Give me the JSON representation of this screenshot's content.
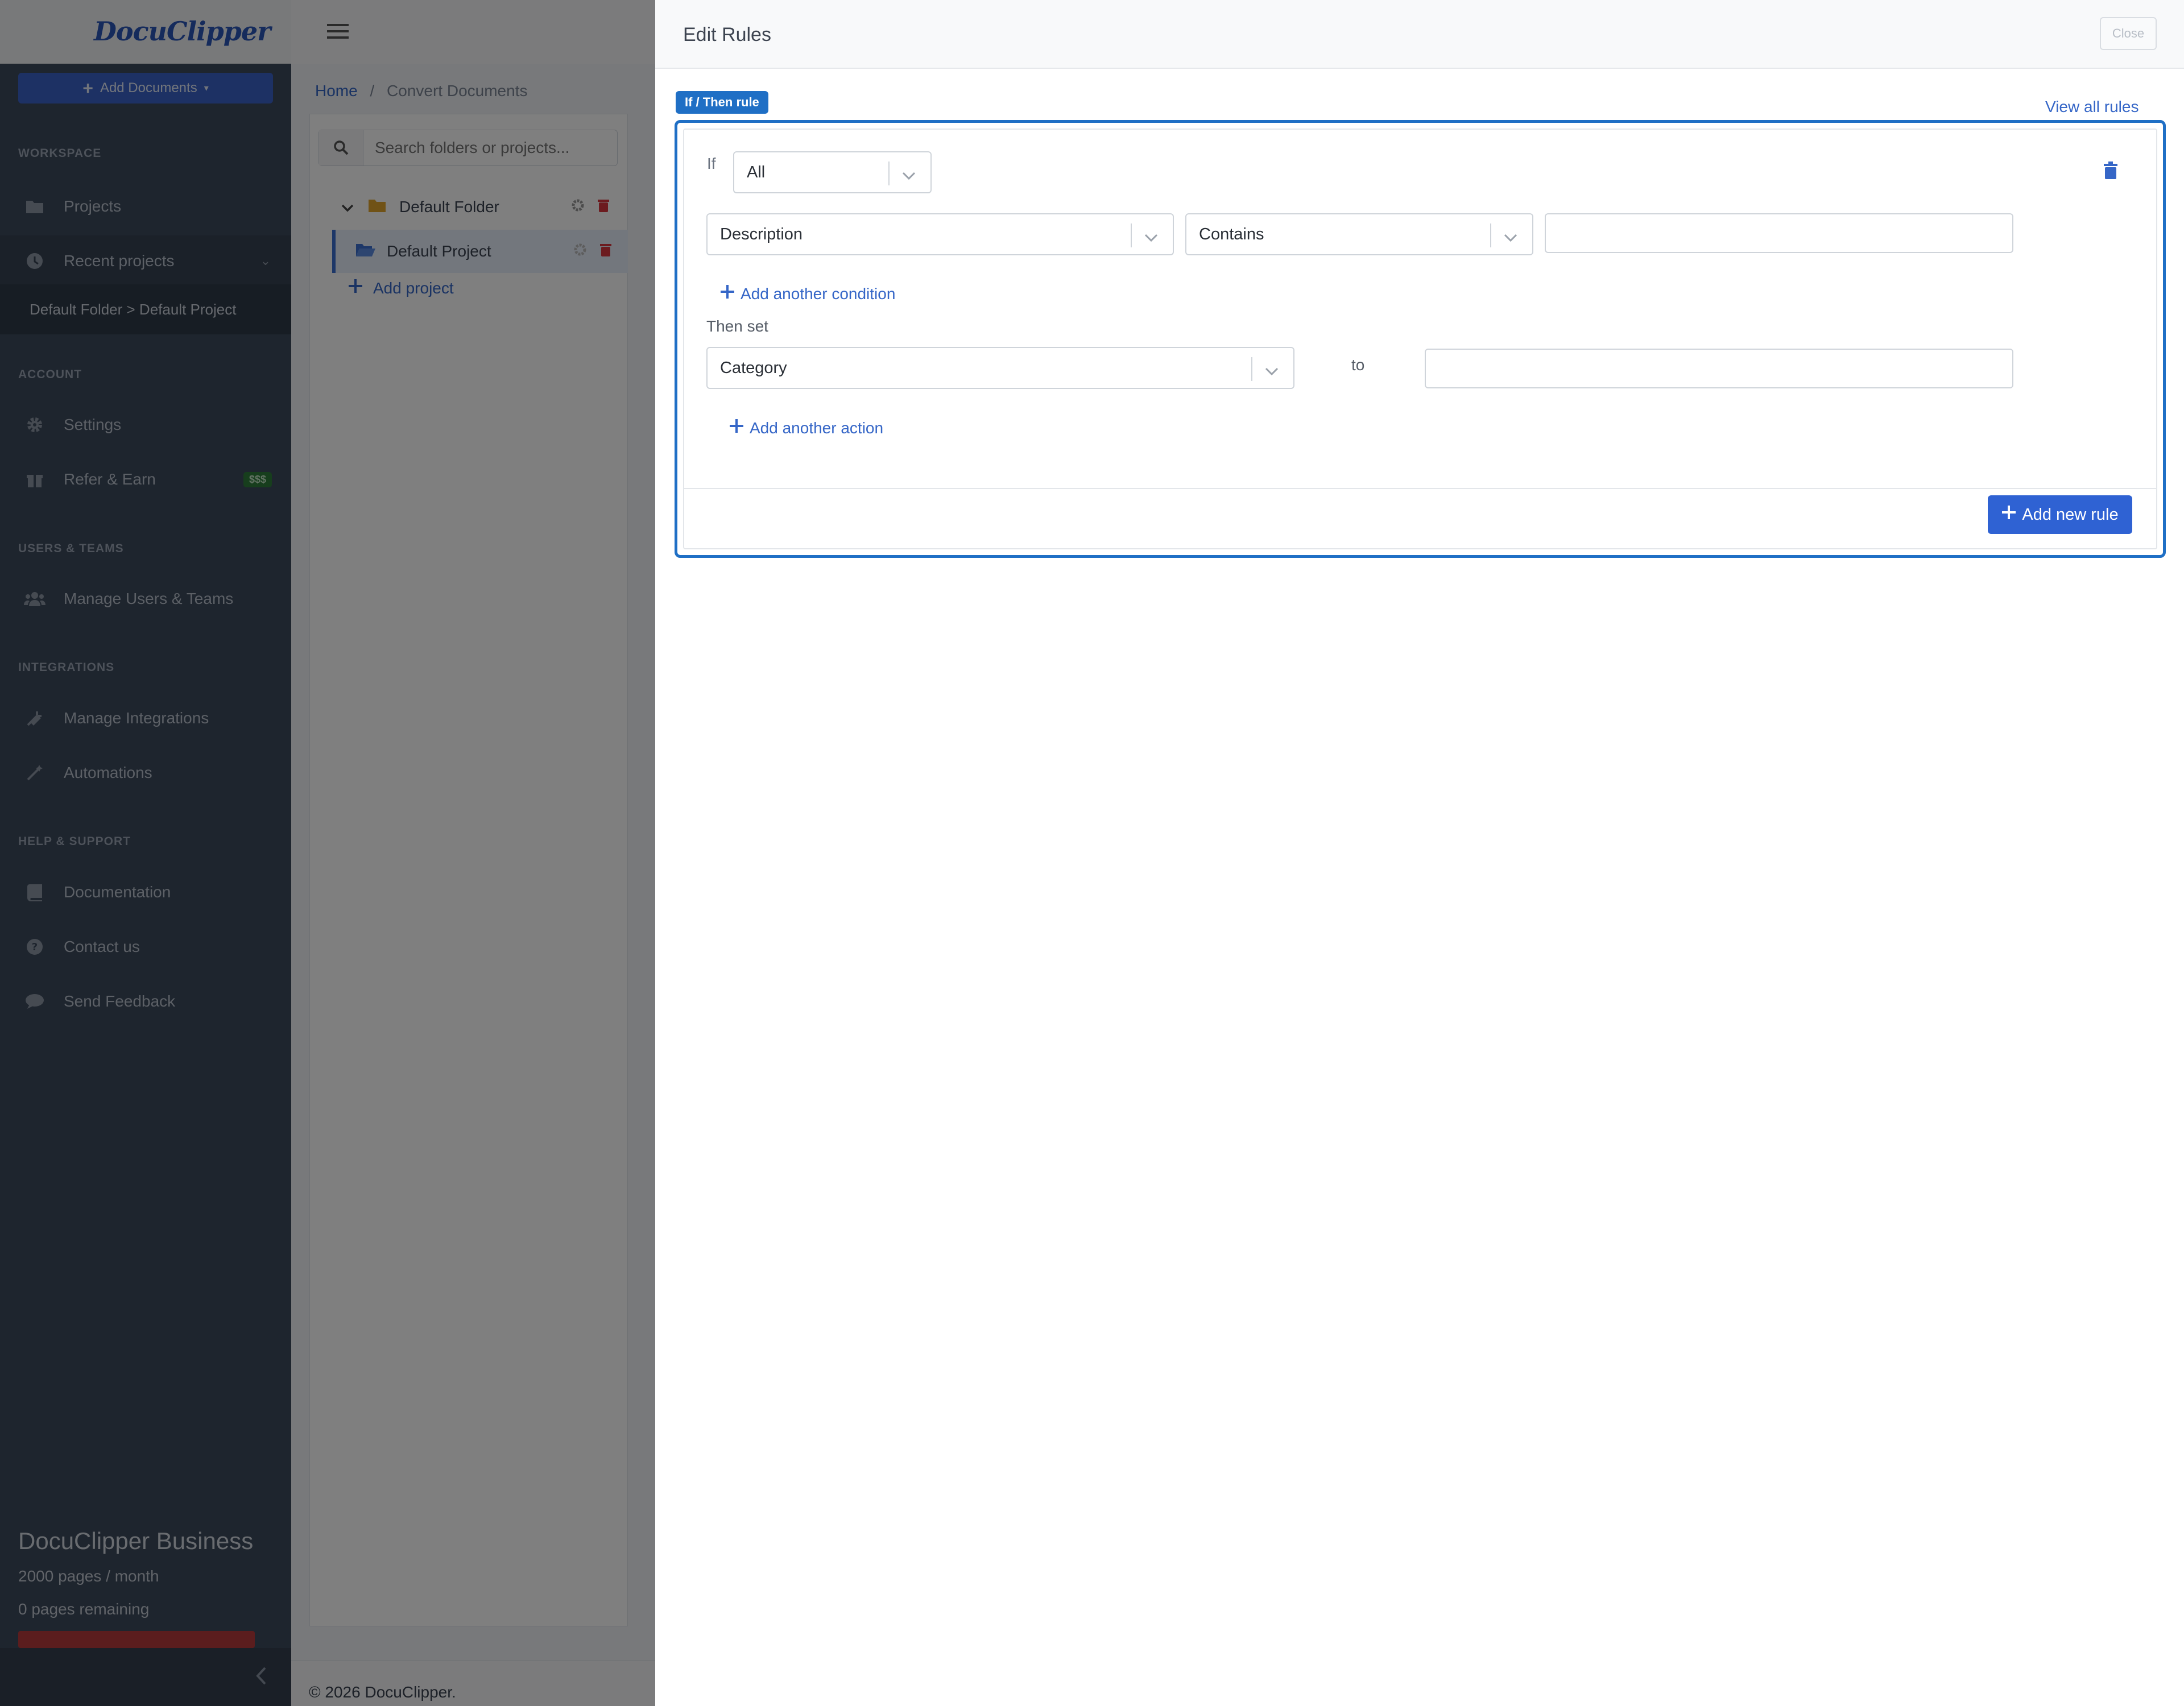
{
  "app": {
    "logo": "DocuClipper"
  },
  "sidebar": {
    "add_documents": "Add Documents",
    "sections": {
      "workspace": "WORKSPACE",
      "account": "ACCOUNT",
      "users_teams": "USERS & TEAMS",
      "integrations": "INTEGRATIONS",
      "help_support": "HELP & SUPPORT"
    },
    "items": {
      "projects": "Projects",
      "recent_projects": "Recent projects",
      "recent_sub": "Default Folder > Default Project",
      "settings": "Settings",
      "refer_earn": "Refer & Earn",
      "refer_badge": "$$$",
      "manage_users": "Manage Users & Teams",
      "manage_integrations": "Manage Integrations",
      "automations": "Automations",
      "documentation": "Documentation",
      "contact_us": "Contact us",
      "send_feedback": "Send Feedback"
    },
    "plan": {
      "name": "DocuClipper Business",
      "pages_per_month": "2000 pages / month",
      "pages_remaining": "0 pages remaining"
    }
  },
  "main": {
    "breadcrumb": {
      "home": "Home",
      "separator": "/",
      "current": "Convert Documents"
    },
    "search": {
      "placeholder": "Search folders or projects..."
    },
    "tree": {
      "folder": "Default Folder",
      "project": "Default Project",
      "add_project": "Add project"
    },
    "footer": "© 2026 DocuClipper."
  },
  "drawer": {
    "title": "Edit Rules",
    "close": "Close",
    "rule_tag": "If / Then rule",
    "view_all": "View all rules",
    "if_label": "If",
    "match_mode": "All",
    "condition": {
      "field": "Description",
      "operator": "Contains",
      "value": ""
    },
    "add_condition": "Add another condition",
    "then_label": "Then set",
    "action": {
      "field": "Category",
      "to_label": "to",
      "value": ""
    },
    "add_action": "Add another action",
    "add_rule": "Add new rule"
  },
  "colors": {
    "accent": "#2f62d3",
    "rule_border": "#1f6fc5",
    "sidebar": "#3d4a5c",
    "danger": "#d9363e"
  }
}
